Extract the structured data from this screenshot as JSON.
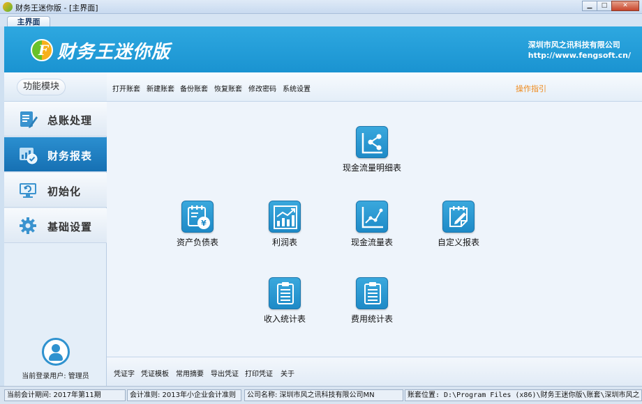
{
  "window": {
    "title": "财务王迷你版 - [主界面]",
    "buttons": {
      "minimize": "▁",
      "maximize": "□",
      "close": "✕"
    }
  },
  "tabs": [
    {
      "label": "主界面",
      "active": true
    }
  ],
  "header": {
    "brand": "财务王迷你版",
    "logo_letter": "F",
    "company": "深圳市风之讯科技有限公司",
    "url": "http://www.fengsoft.cn/"
  },
  "sidebar": {
    "title": "功能模块",
    "items": [
      {
        "label": "总账处理",
        "icon": "ledger-edit-icon",
        "active": false
      },
      {
        "label": "财务报表",
        "icon": "report-chart-icon",
        "active": true
      },
      {
        "label": "初始化",
        "icon": "monitor-refresh-icon",
        "active": false
      },
      {
        "label": "基础设置",
        "icon": "gear-icon",
        "active": false
      }
    ],
    "user_label": "当前登录用户: 管理员"
  },
  "toolbar": {
    "items": [
      "打开账套",
      "新建账套",
      "备份账套",
      "恢复账套",
      "修改密码",
      "系统设置"
    ],
    "guide": "操作指引"
  },
  "reports": {
    "cashflow_detail": {
      "label": "现金流量明细表",
      "icon": "share-graph-icon"
    },
    "balance_sheet": {
      "label": "资产负债表",
      "icon": "yen-calendar-icon"
    },
    "profit": {
      "label": "利润表",
      "icon": "bar-chart-icon"
    },
    "cashflow": {
      "label": "现金流量表",
      "icon": "line-chart-icon"
    },
    "custom": {
      "label": "自定义报表",
      "icon": "notepad-edit-icon"
    },
    "income_stats": {
      "label": "收入统计表",
      "icon": "clipboard-icon"
    },
    "expense_stats": {
      "label": "费用统计表",
      "icon": "clipboard-icon"
    }
  },
  "bottom_toolbar": {
    "items": [
      "凭证字",
      "凭证模板",
      "常用摘要",
      "导出凭证",
      "打印凭证",
      "关于"
    ]
  },
  "status": {
    "period": "当前会计期间: 2017年第11期",
    "standard": "会计准则: 2013年小企业会计准则",
    "company": "公司名称: 深圳市风之讯科技有限公司MN",
    "location": "账套位置: D:\\Program Files (x86)\\财务王迷你版\\账套\\深圳市风之"
  },
  "colors": {
    "banner": "#1e97d5",
    "tile": "#2a9ad5",
    "guide": "#ef8a1c",
    "active_nav": "#1a78b8"
  }
}
